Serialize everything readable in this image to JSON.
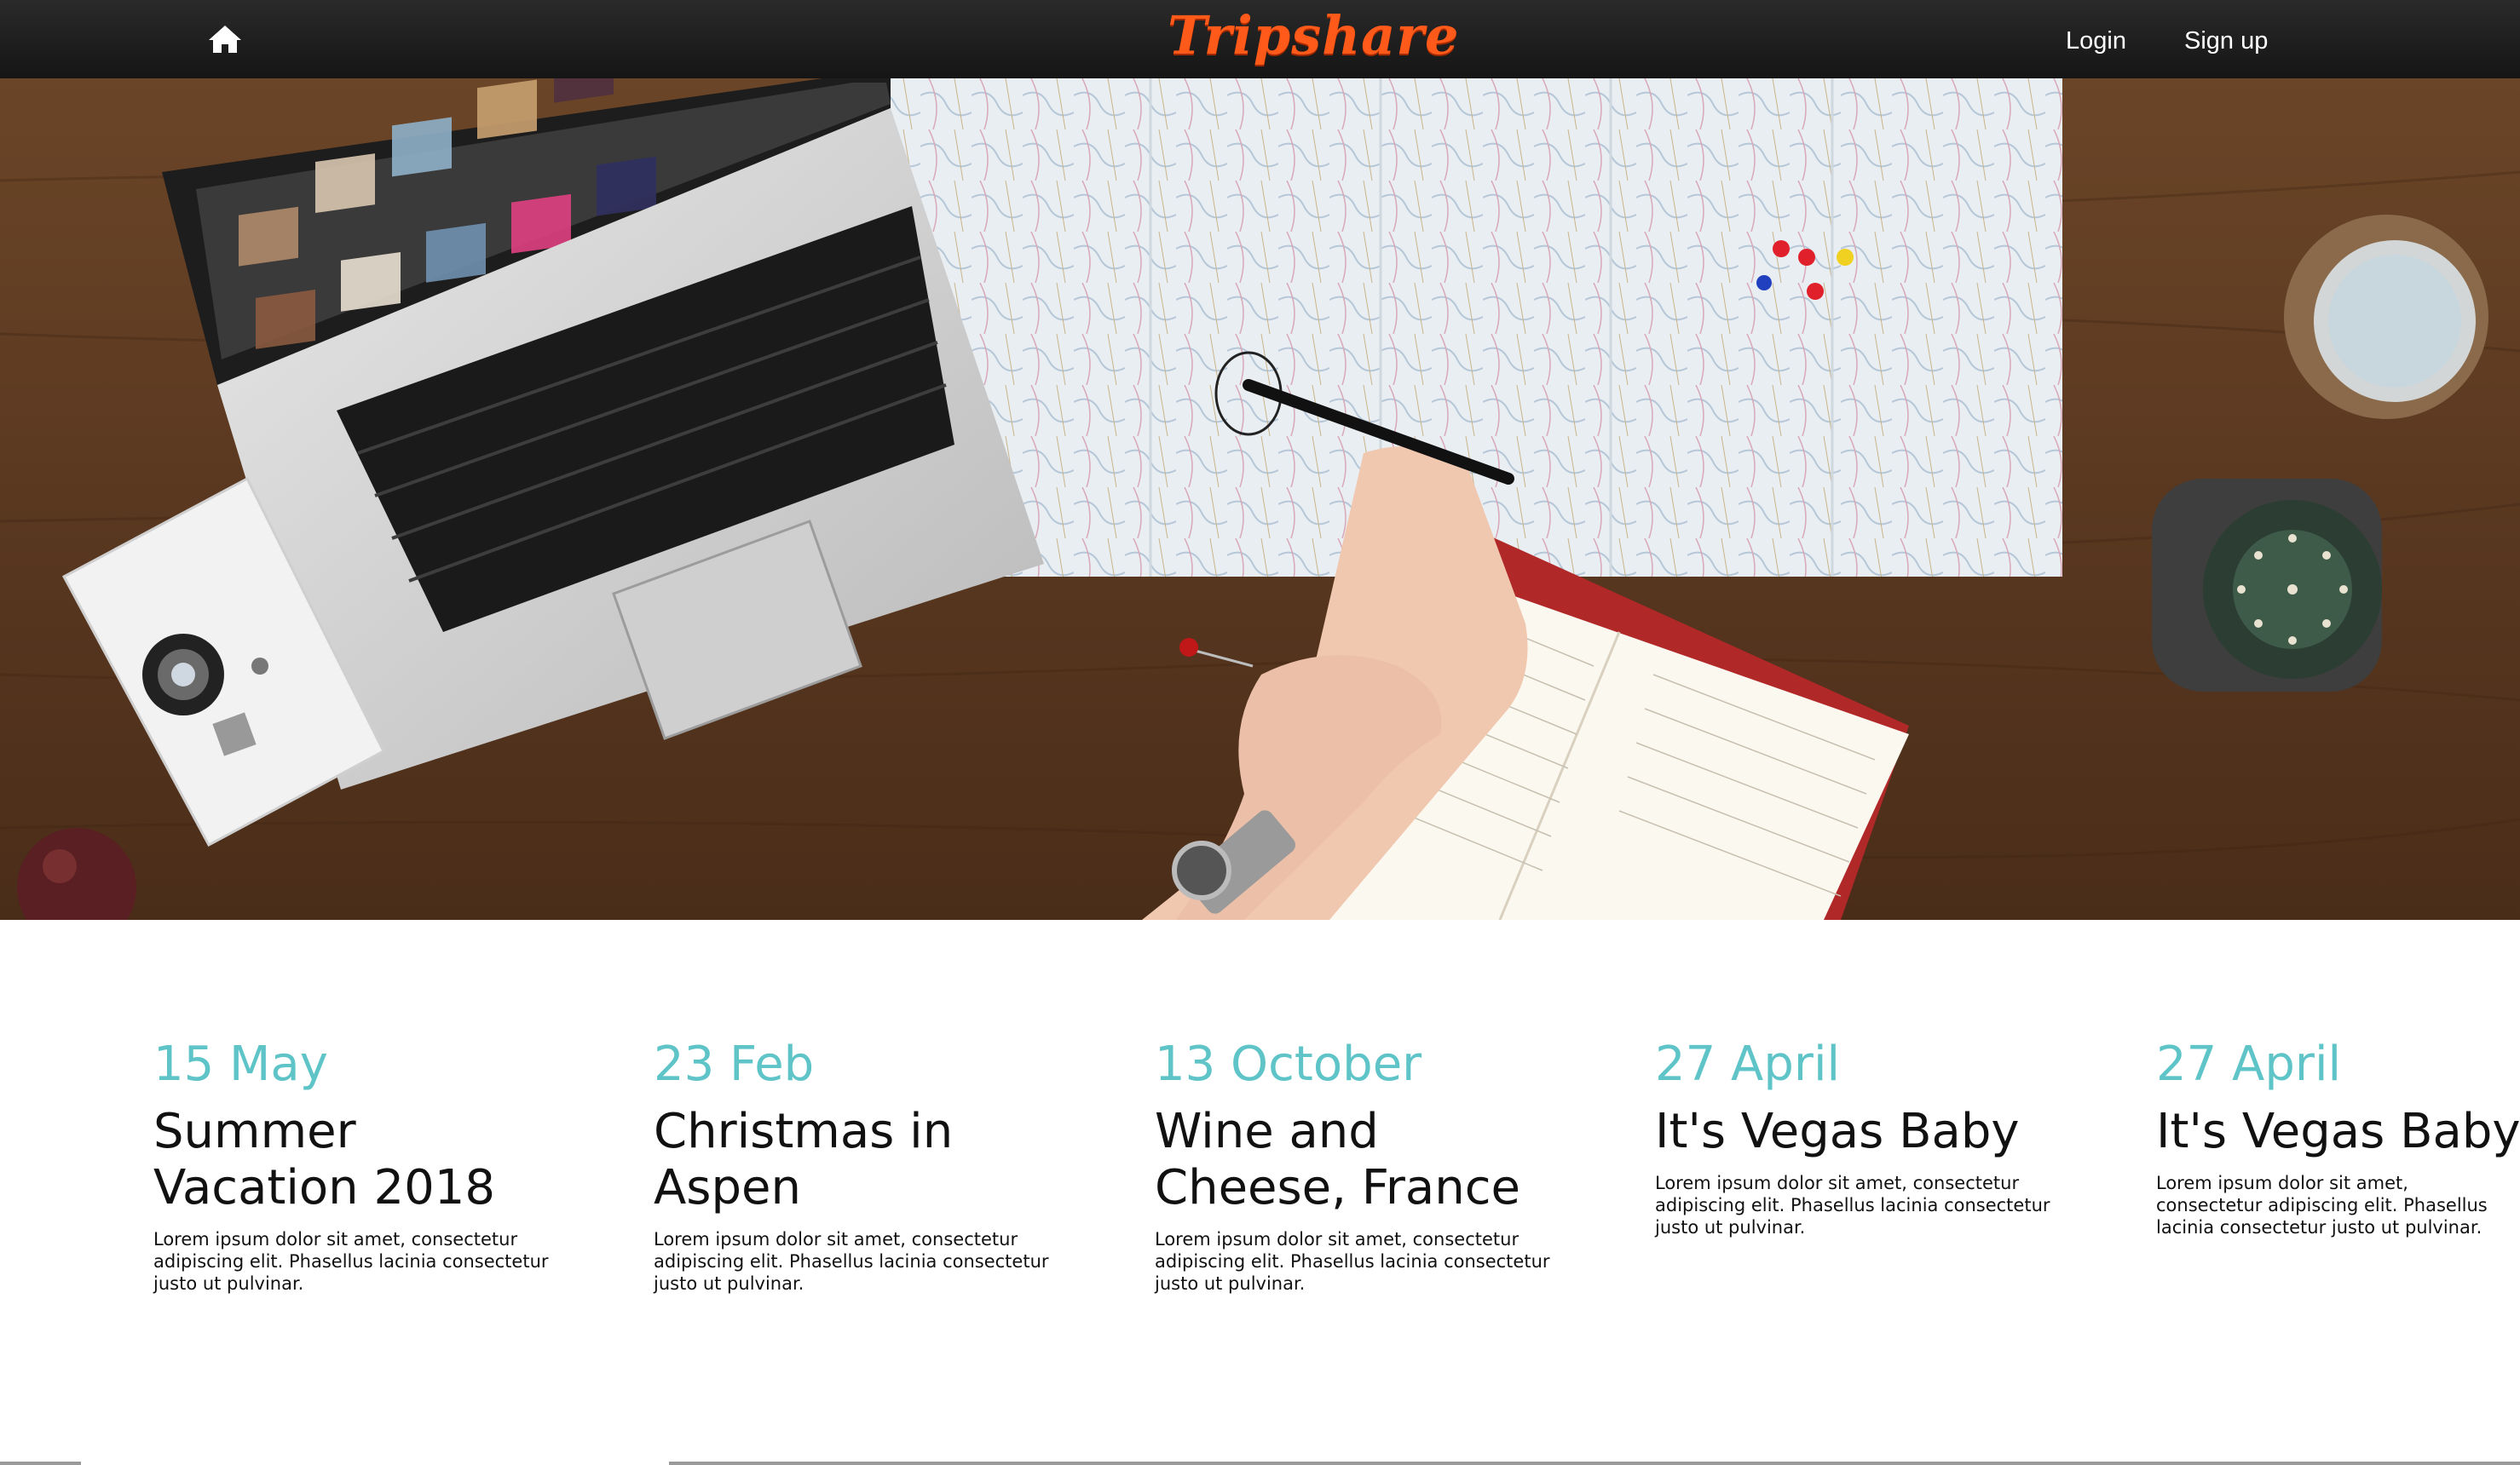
{
  "nav": {
    "brand": "Tripshare",
    "home_icon": "home-icon",
    "login_label": "Login",
    "signup_label": "Sign up"
  },
  "colors": {
    "navbar": "#1c1c1c",
    "brand": "#ff5a1a",
    "date_accent": "#5ec4c8",
    "text": "#111111"
  },
  "trips": [
    {
      "date": "15 May",
      "title": "Summer Vacation 2018",
      "description": "Lorem ipsum dolor sit amet, consectetur adipiscing elit. Phasellus lacinia consectetur justo ut pulvinar."
    },
    {
      "date": "23 Feb",
      "title": "Christmas in Aspen",
      "description": "Lorem ipsum dolor sit amet, consectetur adipiscing elit. Phasellus lacinia consectetur justo ut pulvinar."
    },
    {
      "date": "13 October",
      "title": "Wine and Cheese, France",
      "description": "Lorem ipsum dolor sit amet, consectetur adipiscing elit. Phasellus lacinia consectetur justo ut pulvinar."
    },
    {
      "date": "27 April",
      "title": "It's Vegas Baby",
      "description": "Lorem ipsum dolor sit amet, consectetur adipiscing elit. Phasellus lacinia consectetur justo ut pulvinar."
    },
    {
      "date": "27 April",
      "title": "It's Vegas Baby",
      "description": "Lorem ipsum dolor sit amet, consectetur adipiscing elit. Phasellus lacinia consectetur justo ut pulvinar."
    }
  ]
}
